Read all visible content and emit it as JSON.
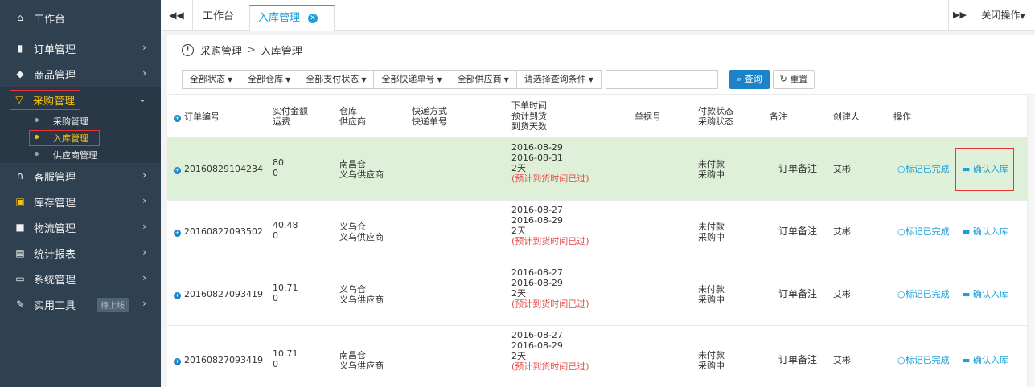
{
  "sidebar": {
    "home": "工作台",
    "items": [
      {
        "label": "订单管理",
        "icon": "clipboard-icon"
      },
      {
        "label": "商品管理",
        "icon": "tag-icon"
      },
      {
        "label": "采购管理",
        "icon": "cart-icon"
      },
      {
        "label": "客服管理",
        "icon": "headset-icon"
      },
      {
        "label": "库存管理",
        "icon": "box-icon"
      },
      {
        "label": "物流管理",
        "icon": "truck-icon"
      },
      {
        "label": "统计报表",
        "icon": "report-icon"
      },
      {
        "label": "系统管理",
        "icon": "monitor-icon"
      },
      {
        "label": "实用工具",
        "icon": "wrench-icon",
        "badge": "待上线"
      }
    ],
    "purchase_sub": [
      "采购管理",
      "入库管理",
      "供应商管理"
    ]
  },
  "tabs": {
    "home": "工作台",
    "current": "入库管理",
    "close_ops": "关闭操作"
  },
  "breadcrumb": {
    "root": "采购管理",
    "sep": ">",
    "current": "入库管理"
  },
  "filters": {
    "buttons": [
      "全部状态",
      "全部仓库",
      "全部支付状态",
      "全部快递单号",
      "全部供应商",
      "请选择查询条件"
    ],
    "search_value": "",
    "query": "查询",
    "reset": "重置"
  },
  "table": {
    "headers": {
      "order_no": "订单编号",
      "amount": "实付金额",
      "freight": "运费",
      "warehouse": "仓库",
      "supplier": "供应商",
      "express": "快递方式",
      "express_no": "快递单号",
      "order_time": "下单时间",
      "eta": "预计到货",
      "days": "到货天数",
      "bill_no": "单据号",
      "pay_status": "付款状态",
      "purchase_status": "采购状态",
      "remark": "备注",
      "creator": "创建人",
      "ops": "操作"
    },
    "rows": [
      {
        "order_no": "20160829104234",
        "amount": "80",
        "freight": "0",
        "warehouse": "南昌仓",
        "supplier": "义乌供应商",
        "order_time": "2016-08-29",
        "eta": "2016-08-31",
        "days": "2天",
        "note": "(预计到货时间已过)",
        "pay_status": "未付款",
        "purchase_status": "采购中",
        "remark": "订单备注",
        "creator": "艾彬",
        "op_done": "标记已完成",
        "op_confirm": "确认入库"
      },
      {
        "order_no": "20160827093502",
        "amount": "40.48",
        "freight": "0",
        "warehouse": "义乌仓",
        "supplier": "义乌供应商",
        "order_time": "2016-08-27",
        "eta": "2016-08-29",
        "days": "2天",
        "note": "(预计到货时间已过)",
        "pay_status": "未付款",
        "purchase_status": "采购中",
        "remark": "订单备注",
        "creator": "艾彬",
        "op_done": "标记已完成",
        "op_confirm": "确认入库"
      },
      {
        "order_no": "20160827093419",
        "amount": "10.71",
        "freight": "0",
        "warehouse": "义乌仓",
        "supplier": "义乌供应商",
        "order_time": "2016-08-27",
        "eta": "2016-08-29",
        "days": "2天",
        "note": "(预计到货时间已过)",
        "pay_status": "未付款",
        "purchase_status": "采购中",
        "remark": "订单备注",
        "creator": "艾彬",
        "op_done": "标记已完成",
        "op_confirm": "确认入库"
      },
      {
        "order_no": "20160827093419",
        "amount": "10.71",
        "freight": "0",
        "warehouse": "南昌仓",
        "supplier": "义乌供应商",
        "order_time": "2016-08-27",
        "eta": "2016-08-29",
        "days": "2天",
        "note": "(预计到货时间已过)",
        "pay_status": "未付款",
        "purchase_status": "采购中",
        "remark": "订单备注",
        "creator": "艾彬",
        "op_done": "标记已完成",
        "op_confirm": "确认入库"
      }
    ]
  }
}
